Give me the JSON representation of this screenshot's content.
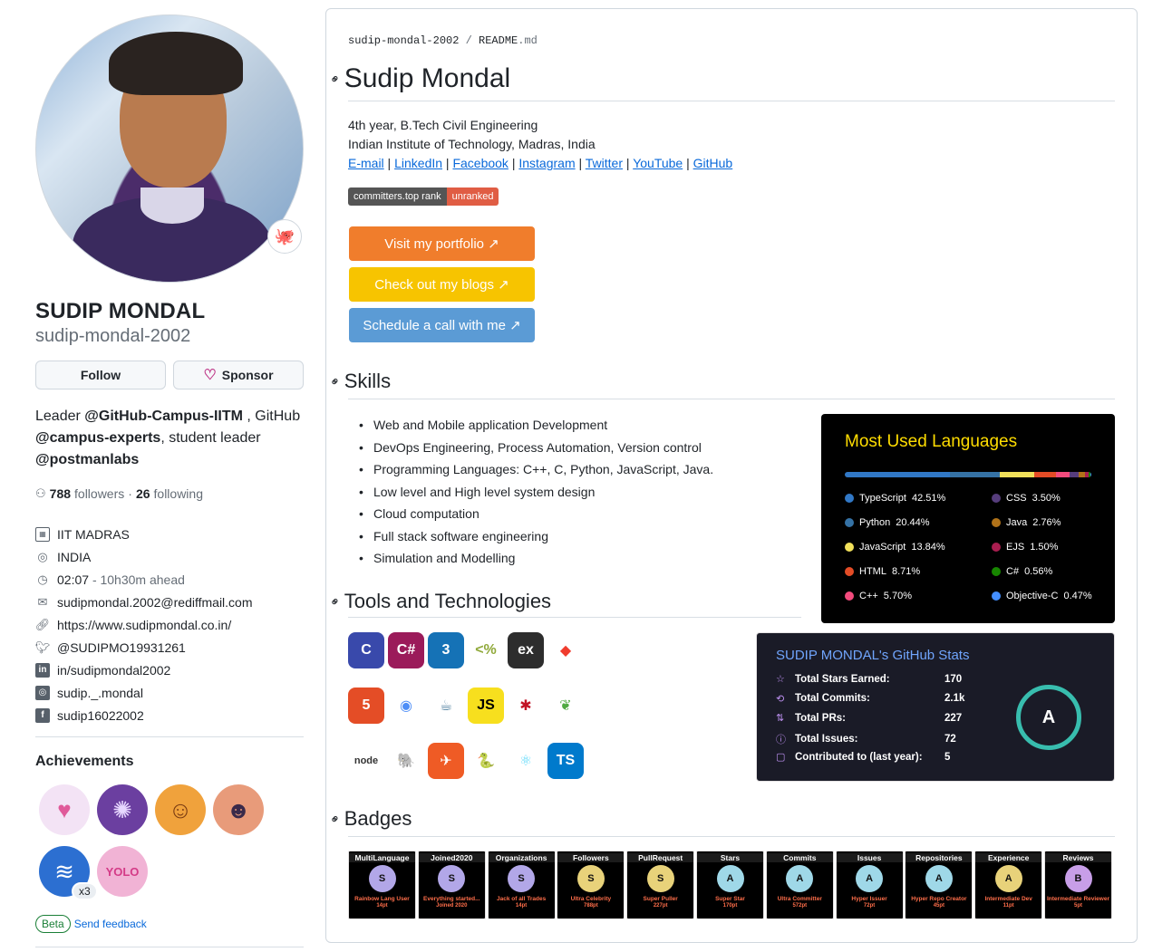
{
  "profile": {
    "full_name": "SUDIP MONDAL",
    "username": "sudip-mondal-2002",
    "follow_label": "Follow",
    "sponsor_label": "Sponsor",
    "bio_lead": "Leader ",
    "bio_org1": "@GitHub-Campus-IITM",
    "bio_mid": " , GitHub ",
    "bio_org2": "@campus-experts",
    "bio_mid2": ", student leader ",
    "bio_org3": "@postmanlabs",
    "followers_count": "788",
    "followers_label": "followers",
    "sep": "·",
    "following_count": "26",
    "following_label": "following",
    "details": {
      "org": "IIT MADRAS",
      "location": "INDIA",
      "time": "02:07",
      "time_offset": "- 10h30m ahead",
      "email": "sudipmondal.2002@rediffmail.com",
      "website": "https://www.sudipmondal.co.in/",
      "twitter": "@SUDIPMO19931261",
      "linkedin": "in/sudipmondal2002",
      "instagram": "sudip._.mondal",
      "facebook": "sudip16022002"
    },
    "achievements_title": "Achievements",
    "achievement_multiplier": "x3",
    "beta_label": "Beta",
    "feedback_label": "Send feedback"
  },
  "readme": {
    "crumb_repo": "sudip-mondal-2002",
    "crumb_sep": " / ",
    "crumb_file": "README",
    "crumb_ext": ".md",
    "title": "Sudip Mondal",
    "line1": "4th year, B.Tech Civil Engineering",
    "line2": "Indian Institute of Technology, Madras, India",
    "links": [
      "E-mail",
      "LinkedIn",
      "Facebook",
      "Instagram",
      "Twitter",
      "YouTube",
      "GitHub"
    ],
    "link_sep": " | ",
    "shield_label": "committers.top rank",
    "shield_value": "unranked",
    "cta": [
      {
        "label": "Visit my portfolio ↗",
        "color": "#f07d2c"
      },
      {
        "label": "Check out my blogs ↗",
        "color": "#f7c400"
      },
      {
        "label": "Schedule a call with me ↗",
        "color": "#5b9bd5"
      }
    ],
    "skills_heading": "Skills",
    "skills": [
      "Web and Mobile application Development",
      "DevOps Engineering, Process Automation, Version control",
      "Programming Languages: C++, C, Python, JavaScript, Java.",
      "Low level and High level system design",
      "Cloud computation",
      "Full stack software engineering",
      "Simulation and Modelling"
    ],
    "tools_heading": "Tools and Technologies",
    "badges_heading": "Badges"
  },
  "languages": {
    "title": "Most Used Languages",
    "items": [
      {
        "name": "TypeScript",
        "pct": "42.51%",
        "value": 42.51,
        "color": "#3178c6"
      },
      {
        "name": "CSS",
        "pct": "3.50%",
        "value": 3.5,
        "color": "#563d7c"
      },
      {
        "name": "Python",
        "pct": "20.44%",
        "value": 20.44,
        "color": "#3572A5"
      },
      {
        "name": "Java",
        "pct": "2.76%",
        "value": 2.76,
        "color": "#b07219"
      },
      {
        "name": "JavaScript",
        "pct": "13.84%",
        "value": 13.84,
        "color": "#f1e05a"
      },
      {
        "name": "EJS",
        "pct": "1.50%",
        "value": 1.5,
        "color": "#a91e50"
      },
      {
        "name": "HTML",
        "pct": "8.71%",
        "value": 8.71,
        "color": "#e34c26"
      },
      {
        "name": "C#",
        "pct": "0.56%",
        "value": 0.56,
        "color": "#178600"
      },
      {
        "name": "C++",
        "pct": "5.70%",
        "value": 5.7,
        "color": "#f34b7d"
      },
      {
        "name": "Objective-C",
        "pct": "0.47%",
        "value": 0.47,
        "color": "#438eff"
      }
    ]
  },
  "tech_icons": [
    {
      "name": "c-icon",
      "glyph": "C",
      "bg": "#3949ab",
      "fg": "#ffffff"
    },
    {
      "name": "csharp-icon",
      "glyph": "C#",
      "bg": "#9b1b5a",
      "fg": "#ffffff"
    },
    {
      "name": "css3-icon",
      "glyph": "3",
      "bg": "#1572b6",
      "fg": "#ffffff"
    },
    {
      "name": "ejs-icon",
      "glyph": "<%",
      "bg": "#ffffff",
      "fg": "#90a93a"
    },
    {
      "name": "express-icon",
      "glyph": "ex",
      "bg": "#2d2d2d",
      "fg": "#ffffff"
    },
    {
      "name": "git-icon",
      "glyph": "◆",
      "bg": "#ffffff",
      "fg": "#f03c2e"
    },
    {
      "name": "html5-icon",
      "glyph": "5",
      "bg": "#e44d26",
      "fg": "#ffffff"
    },
    {
      "name": "ionic-icon",
      "glyph": "◉",
      "bg": "#ffffff",
      "fg": "#4e8ef7"
    },
    {
      "name": "java-icon",
      "glyph": "☕",
      "bg": "#ffffff",
      "fg": "#5382a1"
    },
    {
      "name": "javascript-icon",
      "glyph": "JS",
      "bg": "#f7df1e",
      "fg": "#000000"
    },
    {
      "name": "jest-icon",
      "glyph": "✱",
      "bg": "#ffffff",
      "fg": "#c21325"
    },
    {
      "name": "mongodb-icon",
      "glyph": "❦",
      "bg": "#ffffff",
      "fg": "#4faa41"
    },
    {
      "name": "nodejs-icon",
      "glyph": "node",
      "bg": "#ffffff",
      "fg": "#333333"
    },
    {
      "name": "postgresql-icon",
      "glyph": "🐘",
      "bg": "#ffffff",
      "fg": "#336791"
    },
    {
      "name": "postman-icon",
      "glyph": "✈",
      "bg": "#ef5b25",
      "fg": "#ffffff"
    },
    {
      "name": "python-icon",
      "glyph": "🐍",
      "bg": "#ffffff",
      "fg": "#3776ab"
    },
    {
      "name": "react-icon",
      "glyph": "⚛",
      "bg": "#ffffff",
      "fg": "#61dafb"
    },
    {
      "name": "typescript-icon",
      "glyph": "TS",
      "bg": "#007acc",
      "fg": "#ffffff"
    }
  ],
  "stats": {
    "title": "SUDIP MONDAL's GitHub Stats",
    "rows": [
      {
        "label": "Total Stars Earned:",
        "value": "170",
        "icon": "☆"
      },
      {
        "label": "Total Commits:",
        "value": "2.1k",
        "icon": "⟲"
      },
      {
        "label": "Total PRs:",
        "value": "227",
        "icon": "⇅"
      },
      {
        "label": "Total Issues:",
        "value": "72",
        "icon": "ⓘ"
      },
      {
        "label": "Contributed to (last year):",
        "value": "5",
        "icon": "▢"
      }
    ],
    "rank": "A"
  },
  "trophies": [
    {
      "title": "MultiLanguage",
      "rank": "S",
      "sub": "Rainbow Lang User",
      "pts": "14pt",
      "cup": "#b2a7e8"
    },
    {
      "title": "Joined2020",
      "rank": "S",
      "sub": "Everything started...",
      "pts": "Joined 2020",
      "cup": "#b2a7e8"
    },
    {
      "title": "Organizations",
      "rank": "S",
      "sub": "Jack of all Trades",
      "pts": "14pt",
      "cup": "#b2a7e8"
    },
    {
      "title": "Followers",
      "rank": "S",
      "sub": "Ultra Celebrity",
      "pts": "788pt",
      "cup": "#e8d27a"
    },
    {
      "title": "PullRequest",
      "rank": "S",
      "sub": "Super Puller",
      "pts": "227pt",
      "cup": "#e8d27a"
    },
    {
      "title": "Stars",
      "rank": "A",
      "sub": "Super Star",
      "pts": "170pt",
      "cup": "#9fd8e8"
    },
    {
      "title": "Commits",
      "rank": "A",
      "sub": "Ultra Committer",
      "pts": "572pt",
      "cup": "#9fd8e8"
    },
    {
      "title": "Issues",
      "rank": "A",
      "sub": "Hyper Issuer",
      "pts": "72pt",
      "cup": "#9fd8e8"
    },
    {
      "title": "Repositories",
      "rank": "A",
      "sub": "Hyper Repo Creator",
      "pts": "45pt",
      "cup": "#9fd8e8"
    },
    {
      "title": "Experience",
      "rank": "A",
      "sub": "Intermediate Dev",
      "pts": "11pt",
      "cup": "#e8d27a"
    },
    {
      "title": "Reviews",
      "rank": "B",
      "sub": "Intermediate Reviewer",
      "pts": "5pt",
      "cup": "#c89ee8"
    }
  ],
  "achievements": [
    {
      "name": "heart-on-sleeve-badge",
      "glyph": "♥",
      "bg": "#f3e3f5",
      "fg": "#e05a9a"
    },
    {
      "name": "galaxy-brain-badge",
      "glyph": "✺",
      "bg": "#6b3fa0",
      "fg": "#e7d8ff"
    },
    {
      "name": "pull-shark-badge",
      "glyph": "☺",
      "bg": "#f0a23c",
      "fg": "#7a3b12"
    },
    {
      "name": "quickdraw-badge",
      "glyph": "☻",
      "bg": "#e89b7a",
      "fg": "#3a2a4a"
    },
    {
      "name": "shark-badge",
      "glyph": "≋",
      "bg": "#2c6fd1",
      "fg": "#ffffff"
    },
    {
      "name": "yolo-badge",
      "glyph": "YOLO",
      "bg": "#f1b3d5",
      "fg": "#d43b87"
    }
  ]
}
